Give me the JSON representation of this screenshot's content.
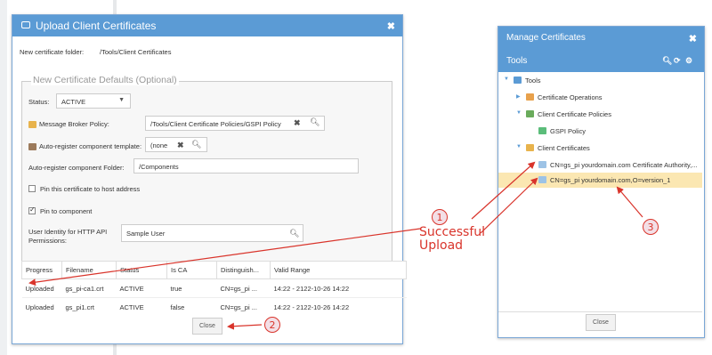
{
  "upload": {
    "title": "Upload Client Certificates",
    "folder_label": "New certificate folder:",
    "folder_value": "/Tools/Client Certificates",
    "defaults_legend": "New Certificate Defaults (Optional)",
    "status_label": "Status:",
    "status_value": "ACTIVE",
    "broker_label": "Message Broker Policy:",
    "broker_value": "/Tools/Client Certificate Policies/GSPI Policy",
    "autoreg_template_label": "Auto-register component template:",
    "autoreg_template_value": "(none",
    "autoreg_folder_label": "Auto-register component Folder:",
    "autoreg_folder_value": "/Components",
    "pin_host_label": "Pin this certificate to host address",
    "pin_component_label": "Pin to component",
    "user_identity_label_1": "User Identity for HTTP API",
    "user_identity_label_2": "Permissions:",
    "user_identity_value": "Sample  User",
    "columns": [
      "Progress",
      "Filename",
      "Status",
      "Is CA",
      "Distinguish...",
      "Valid Range"
    ],
    "rows": [
      [
        "Uploaded",
        "gs_pi-ca1.crt",
        "ACTIVE",
        "true",
        "CN=gs_pi ...",
        "14:22 - 2122-10-26 14:22"
      ],
      [
        "Uploaded",
        "gs_pi1.crt",
        "ACTIVE",
        "false",
        "CN=gs_pi ...",
        "14:22 - 2122-10-26 14:22"
      ]
    ],
    "close_label": "Close"
  },
  "manage": {
    "title": "Manage Certificates",
    "tools_header": "Tools",
    "tree": {
      "root": "Tools",
      "cert_ops": "Certificate Operations",
      "client_policies": "Client Certificate Policies",
      "gspi_policy": "GSPI Policy",
      "client_certs": "Client Certificates",
      "cert1": "CN=gs_pi yourdomain.com Certificate Authority,...",
      "cert2": "CN=gs_pi yourdomain.com,O=version_1"
    },
    "close_label": "Close"
  },
  "annotations": {
    "one": "1",
    "two": "2",
    "three": "3",
    "text_line1": "Successful",
    "text_line2": "Upload",
    "color": "#d9342b"
  },
  "colors": {
    "titlebar": "#5b9bd5",
    "selection": "#fbe7b2"
  }
}
